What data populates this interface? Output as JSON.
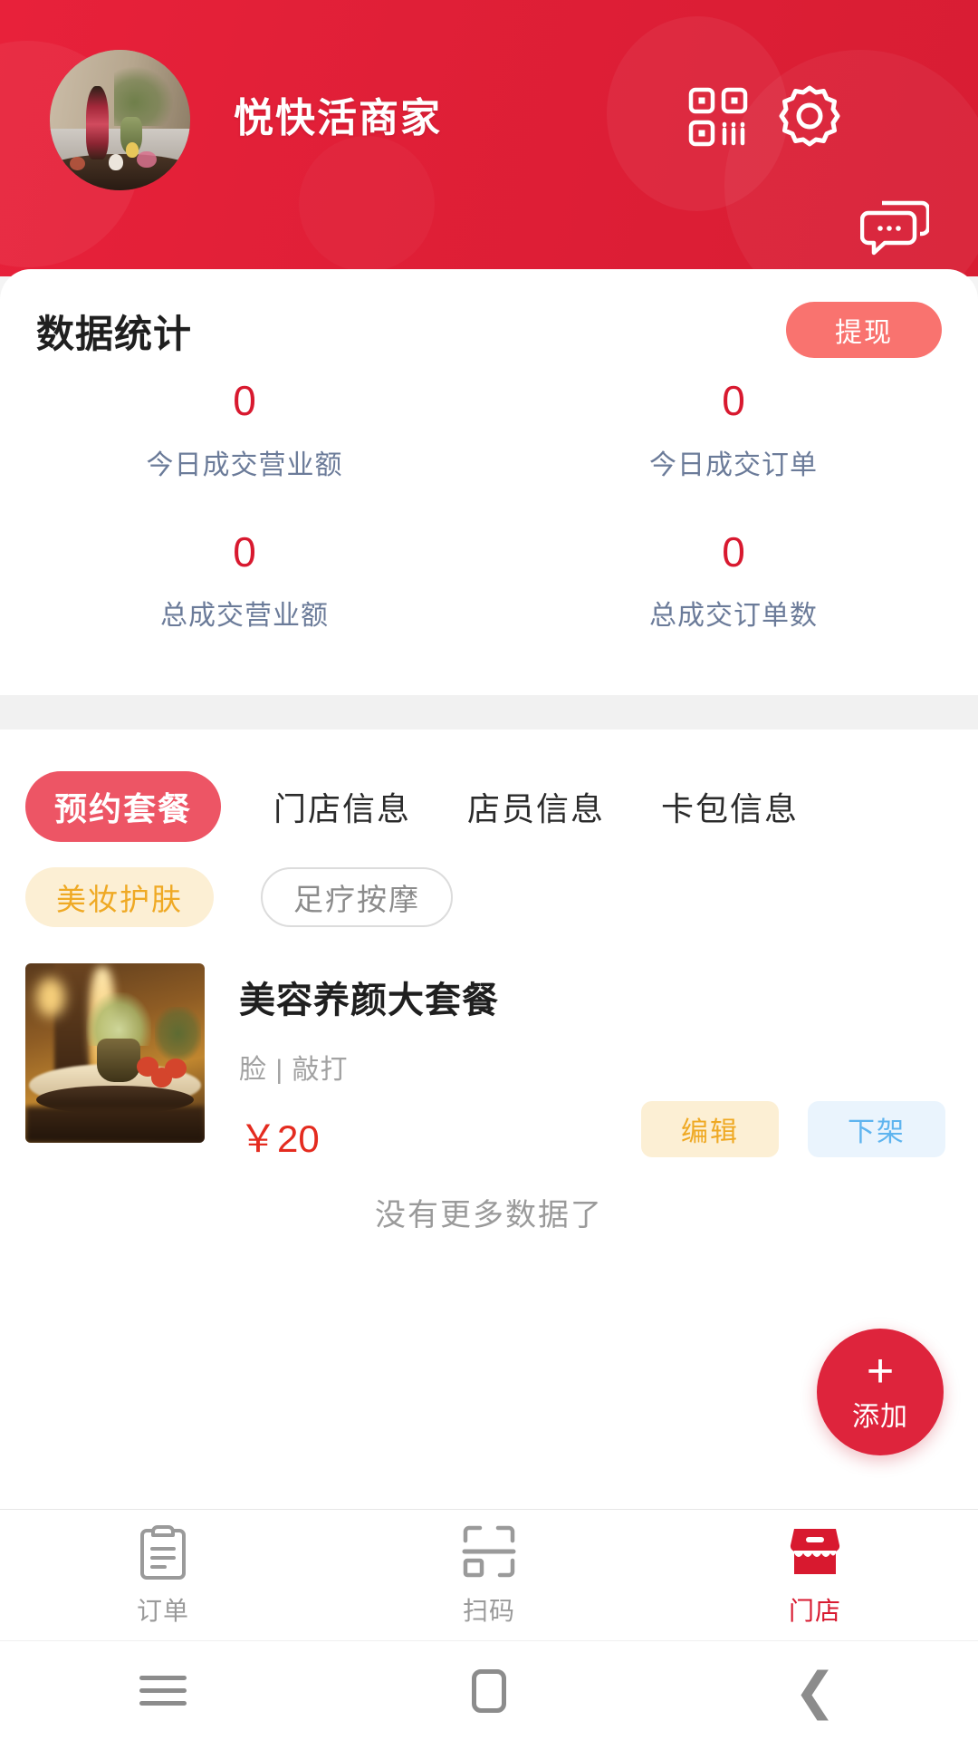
{
  "header": {
    "shop_name": "悦快活商家",
    "avatar_alt": "shop-avatar",
    "icons": {
      "qr": "qr-code-icon",
      "settings": "gear-icon",
      "chat": "chat-bubbles-icon"
    },
    "brand_color": "#e0203a"
  },
  "stats": {
    "title": "数据统计",
    "withdraw_label": "提现",
    "withdraw_color": "#f9736f",
    "value_color": "#d8192f",
    "label_color": "#6b7b99",
    "items": [
      {
        "value": "0",
        "label": "今日成交营业额"
      },
      {
        "value": "0",
        "label": "今日成交订单"
      },
      {
        "value": "0",
        "label": "总成交营业额"
      },
      {
        "value": "0",
        "label": "总成交订单数"
      }
    ]
  },
  "tabs": {
    "active_index": 0,
    "active_color": "#ed5565",
    "items": [
      {
        "label": "预约套餐"
      },
      {
        "label": "门店信息"
      },
      {
        "label": "店员信息"
      },
      {
        "label": "卡包信息"
      }
    ]
  },
  "categories": {
    "selected_index": 0,
    "selected_bg": "#fcefd4",
    "selected_fg": "#efa924",
    "items": [
      {
        "label": "美妆护肤"
      },
      {
        "label": "足疗按摩"
      }
    ]
  },
  "product": {
    "name": "美容养颜大套餐",
    "subtitle": "脸 | 敲打",
    "price": "￥20",
    "price_color": "#e42b1f",
    "thumb_alt": "product-thumbnail",
    "edit_label": "编辑",
    "off_shelf_label": "下架"
  },
  "list_footer": {
    "text": "没有更多数据了"
  },
  "fab": {
    "plus": "+",
    "label": "添加",
    "color": "#de243c"
  },
  "bottom_nav": {
    "active_index": 2,
    "active_color": "#d8192f",
    "items": [
      {
        "label": "订单",
        "icon": "clipboard-icon"
      },
      {
        "label": "扫码",
        "icon": "scan-icon"
      },
      {
        "label": "门店",
        "icon": "store-icon"
      }
    ]
  },
  "system_nav": {
    "recents": "recents-icon",
    "home": "home-icon",
    "back": "back-icon",
    "back_glyph": "❮"
  }
}
